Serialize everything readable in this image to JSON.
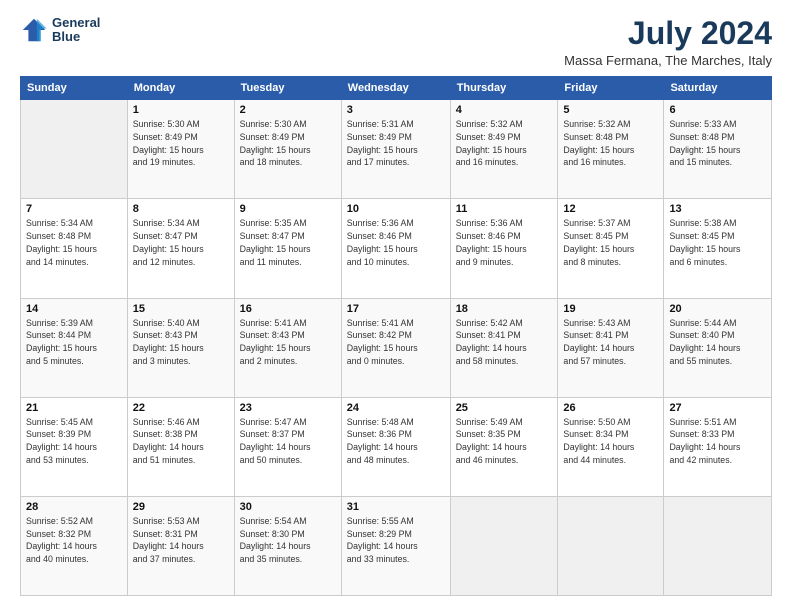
{
  "logo": {
    "line1": "General",
    "line2": "Blue"
  },
  "title": "July 2024",
  "subtitle": "Massa Fermana, The Marches, Italy",
  "header_days": [
    "Sunday",
    "Monday",
    "Tuesday",
    "Wednesday",
    "Thursday",
    "Friday",
    "Saturday"
  ],
  "weeks": [
    [
      {
        "day": "",
        "info": ""
      },
      {
        "day": "1",
        "info": "Sunrise: 5:30 AM\nSunset: 8:49 PM\nDaylight: 15 hours\nand 19 minutes."
      },
      {
        "day": "2",
        "info": "Sunrise: 5:30 AM\nSunset: 8:49 PM\nDaylight: 15 hours\nand 18 minutes."
      },
      {
        "day": "3",
        "info": "Sunrise: 5:31 AM\nSunset: 8:49 PM\nDaylight: 15 hours\nand 17 minutes."
      },
      {
        "day": "4",
        "info": "Sunrise: 5:32 AM\nSunset: 8:49 PM\nDaylight: 15 hours\nand 16 minutes."
      },
      {
        "day": "5",
        "info": "Sunrise: 5:32 AM\nSunset: 8:48 PM\nDaylight: 15 hours\nand 16 minutes."
      },
      {
        "day": "6",
        "info": "Sunrise: 5:33 AM\nSunset: 8:48 PM\nDaylight: 15 hours\nand 15 minutes."
      }
    ],
    [
      {
        "day": "7",
        "info": "Sunrise: 5:34 AM\nSunset: 8:48 PM\nDaylight: 15 hours\nand 14 minutes."
      },
      {
        "day": "8",
        "info": "Sunrise: 5:34 AM\nSunset: 8:47 PM\nDaylight: 15 hours\nand 12 minutes."
      },
      {
        "day": "9",
        "info": "Sunrise: 5:35 AM\nSunset: 8:47 PM\nDaylight: 15 hours\nand 11 minutes."
      },
      {
        "day": "10",
        "info": "Sunrise: 5:36 AM\nSunset: 8:46 PM\nDaylight: 15 hours\nand 10 minutes."
      },
      {
        "day": "11",
        "info": "Sunrise: 5:36 AM\nSunset: 8:46 PM\nDaylight: 15 hours\nand 9 minutes."
      },
      {
        "day": "12",
        "info": "Sunrise: 5:37 AM\nSunset: 8:45 PM\nDaylight: 15 hours\nand 8 minutes."
      },
      {
        "day": "13",
        "info": "Sunrise: 5:38 AM\nSunset: 8:45 PM\nDaylight: 15 hours\nand 6 minutes."
      }
    ],
    [
      {
        "day": "14",
        "info": "Sunrise: 5:39 AM\nSunset: 8:44 PM\nDaylight: 15 hours\nand 5 minutes."
      },
      {
        "day": "15",
        "info": "Sunrise: 5:40 AM\nSunset: 8:43 PM\nDaylight: 15 hours\nand 3 minutes."
      },
      {
        "day": "16",
        "info": "Sunrise: 5:41 AM\nSunset: 8:43 PM\nDaylight: 15 hours\nand 2 minutes."
      },
      {
        "day": "17",
        "info": "Sunrise: 5:41 AM\nSunset: 8:42 PM\nDaylight: 15 hours\nand 0 minutes."
      },
      {
        "day": "18",
        "info": "Sunrise: 5:42 AM\nSunset: 8:41 PM\nDaylight: 14 hours\nand 58 minutes."
      },
      {
        "day": "19",
        "info": "Sunrise: 5:43 AM\nSunset: 8:41 PM\nDaylight: 14 hours\nand 57 minutes."
      },
      {
        "day": "20",
        "info": "Sunrise: 5:44 AM\nSunset: 8:40 PM\nDaylight: 14 hours\nand 55 minutes."
      }
    ],
    [
      {
        "day": "21",
        "info": "Sunrise: 5:45 AM\nSunset: 8:39 PM\nDaylight: 14 hours\nand 53 minutes."
      },
      {
        "day": "22",
        "info": "Sunrise: 5:46 AM\nSunset: 8:38 PM\nDaylight: 14 hours\nand 51 minutes."
      },
      {
        "day": "23",
        "info": "Sunrise: 5:47 AM\nSunset: 8:37 PM\nDaylight: 14 hours\nand 50 minutes."
      },
      {
        "day": "24",
        "info": "Sunrise: 5:48 AM\nSunset: 8:36 PM\nDaylight: 14 hours\nand 48 minutes."
      },
      {
        "day": "25",
        "info": "Sunrise: 5:49 AM\nSunset: 8:35 PM\nDaylight: 14 hours\nand 46 minutes."
      },
      {
        "day": "26",
        "info": "Sunrise: 5:50 AM\nSunset: 8:34 PM\nDaylight: 14 hours\nand 44 minutes."
      },
      {
        "day": "27",
        "info": "Sunrise: 5:51 AM\nSunset: 8:33 PM\nDaylight: 14 hours\nand 42 minutes."
      }
    ],
    [
      {
        "day": "28",
        "info": "Sunrise: 5:52 AM\nSunset: 8:32 PM\nDaylight: 14 hours\nand 40 minutes."
      },
      {
        "day": "29",
        "info": "Sunrise: 5:53 AM\nSunset: 8:31 PM\nDaylight: 14 hours\nand 37 minutes."
      },
      {
        "day": "30",
        "info": "Sunrise: 5:54 AM\nSunset: 8:30 PM\nDaylight: 14 hours\nand 35 minutes."
      },
      {
        "day": "31",
        "info": "Sunrise: 5:55 AM\nSunset: 8:29 PM\nDaylight: 14 hours\nand 33 minutes."
      },
      {
        "day": "",
        "info": ""
      },
      {
        "day": "",
        "info": ""
      },
      {
        "day": "",
        "info": ""
      }
    ]
  ]
}
